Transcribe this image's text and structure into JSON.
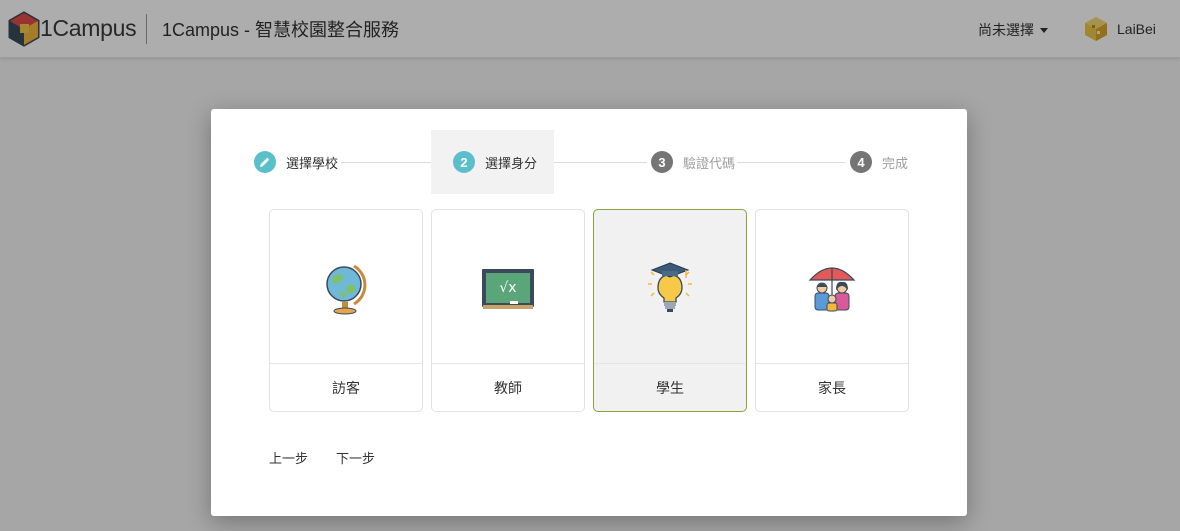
{
  "header": {
    "brand": "1Campus",
    "app_title": "1Campus - 智慧校園整合服務",
    "role_select": "尚未選擇",
    "user_name": "LaiBei"
  },
  "stepper": [
    {
      "number": "",
      "label": "選擇學校",
      "state": "done"
    },
    {
      "number": "2",
      "label": "選擇身分",
      "state": "active"
    },
    {
      "number": "3",
      "label": "驗證代碼",
      "state": "pending"
    },
    {
      "number": "4",
      "label": "完成",
      "state": "pending"
    }
  ],
  "roles": [
    {
      "label": "訪客",
      "icon": "globe-icon",
      "selected": false
    },
    {
      "label": "教師",
      "icon": "chalkboard-icon",
      "selected": false
    },
    {
      "label": "學生",
      "icon": "graduation-bulb-icon",
      "selected": true
    },
    {
      "label": "家長",
      "icon": "family-umbrella-icon",
      "selected": false
    }
  ],
  "nav": {
    "prev": "上一步",
    "next": "下一步"
  },
  "colors": {
    "accent_teal": "#5bbfcb",
    "step_gray": "#757575",
    "selected_border": "#8aa33a"
  }
}
